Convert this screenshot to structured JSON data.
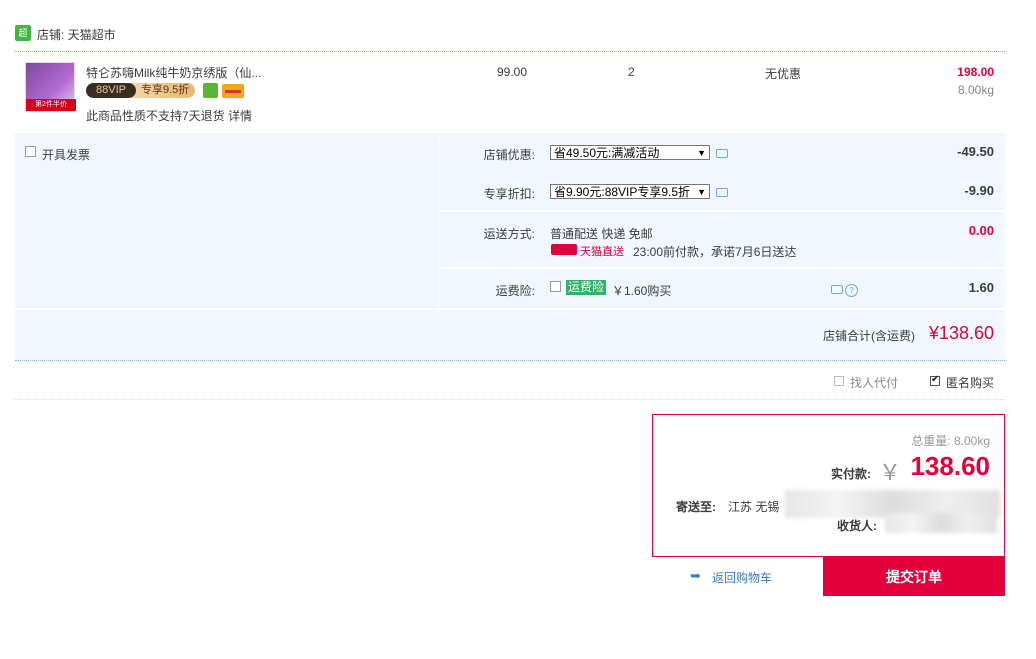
{
  "store": {
    "icon_text": "超市",
    "label": "店铺: 天猫超市"
  },
  "item": {
    "title": "特仑苏嗨Milk纯牛奶京绣版（仙...",
    "thumb_badge": "第2件半价",
    "vip_tag": "88VIP",
    "vip_rate": "专享9.5折",
    "notice": "此商品性质不支持7天退货 详情",
    "price": "99.00",
    "qty": "2",
    "promo": "无优惠",
    "subtotal": "198.00",
    "weight": "8.00kg"
  },
  "invoice": {
    "label": "开具发票"
  },
  "store_discount": {
    "label": "店铺优惠:",
    "selected": "省49.50元:满减活动",
    "amount": "-49.50"
  },
  "vip_discount": {
    "label": "专享折扣:",
    "selected": "省9.90元:88VIP专享9.5折",
    "amount": "-9.90"
  },
  "shipping": {
    "label": "运送方式:",
    "method": "普通配送 快递 免邮",
    "tmall_direct": "天猫直送",
    "promise": "23:00前付款，承诺7月6日送达",
    "amount": "0.00"
  },
  "insurance": {
    "label": "运费险:",
    "badge": "运费险",
    "price_text": "￥1.60购买",
    "amount": "1.60"
  },
  "store_total": {
    "label": "店铺合计(含运费)",
    "value": "¥138.60"
  },
  "options": {
    "proxy_pay": "找人代付",
    "anonymous": "匿名购买"
  },
  "summary": {
    "weight_label": "总重量:",
    "weight": "8.00kg",
    "pay_label": "实付款:",
    "currency": "￥",
    "pay_amount": "138.60",
    "ship_to_label": "寄送至:",
    "ship_to": "江苏 无锡",
    "receiver_label": "收货人:"
  },
  "actions": {
    "back": "返回购物车",
    "submit": "提交订单"
  },
  "colors": {
    "accent": "#e4003a",
    "link": "#3b79c6",
    "panel": "#f2f7ff"
  }
}
